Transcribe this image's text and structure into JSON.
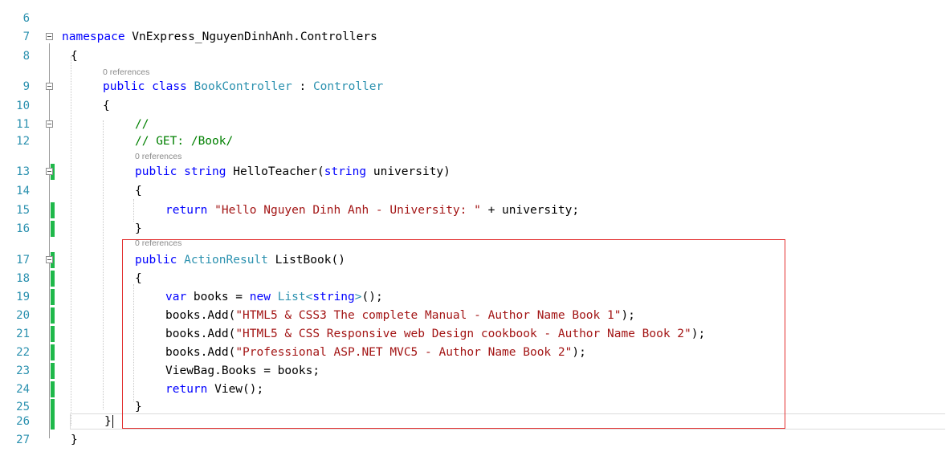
{
  "lines": [
    {
      "num": "6"
    },
    {
      "num": "7",
      "parts": [
        [
          "kw",
          "namespace"
        ],
        [
          "",
          "VnExpress_NguyenDinhAnh.Controllers"
        ]
      ],
      "sep": " "
    },
    {
      "num": "8",
      "text": "{"
    },
    {
      "lens": "0 references"
    },
    {
      "num": "9",
      "text_public": "public",
      "text_class": "class",
      "class_name": "BookController",
      "colon": ":",
      "base": "Controller"
    },
    {
      "num": "10",
      "text": "{"
    },
    {
      "num": "11",
      "comment": "//"
    },
    {
      "num": "12",
      "comment": "// GET: /Book/"
    },
    {
      "lens": "0 references"
    },
    {
      "num": "13"
    },
    {
      "num": "14",
      "text": "{"
    },
    {
      "num": "15"
    },
    {
      "num": "16",
      "text": "}"
    },
    {
      "lens": "0 references"
    },
    {
      "num": "17"
    },
    {
      "num": "18",
      "text": "{"
    },
    {
      "num": "19"
    },
    {
      "num": "20"
    },
    {
      "num": "21"
    },
    {
      "num": "22"
    },
    {
      "num": "23"
    },
    {
      "num": "24"
    },
    {
      "num": "25",
      "text": "}"
    },
    {
      "num": "26",
      "text": "}"
    },
    {
      "num": "27",
      "text": "}"
    }
  ],
  "code": {
    "l6": "6",
    "l7": "7",
    "l8": "8",
    "l9": "9",
    "l10": "10",
    "l11": "11",
    "l12": "12",
    "l13": "13",
    "l14": "14",
    "l15": "15",
    "l16": "16",
    "l17": "17",
    "l18": "18",
    "l19": "19",
    "l20": "20",
    "l21": "21",
    "l22": "22",
    "l23": "23",
    "l24": "24",
    "l25": "25",
    "l26": "26",
    "l27": "27",
    "kw_namespace": "namespace",
    "namespace_name": " VnExpress_NguyenDinhAnh.Controllers",
    "brace_open": "{",
    "brace_close": "}",
    "lens_refs": "0 references",
    "kw_public": "public",
    "kw_class": "class",
    "class_name": "BookController",
    "colon": " : ",
    "base_class": "Controller",
    "comment_1": "//",
    "comment_2": "// GET: /Book/",
    "kw_string": "string",
    "method1_name": " HelloTeacher(",
    "param_name": " university)",
    "kw_return": "return",
    "str_hello": "\"Hello Nguyen Dinh Anh - University: \"",
    "concat_tail": " + university;",
    "type_actionresult": "ActionResult",
    "method2_name": " ListBook()",
    "kw_var": "var",
    "var_books": " books = ",
    "kw_new": "new",
    "type_list": "List",
    "generic_open": "<",
    "generic_close": ">",
    "list_tail": "();",
    "add_call": "books.Add(",
    "str_book1": "\"HTML5 & CSS3 The complete Manual - Author Name Book 1\"",
    "str_book2": "\"HTML5 & CSS Responsive web Design cookbook - Author Name Book 2\"",
    "str_book3": "\"Professional ASP.NET MVC5 - Author Name Book 2\"",
    "call_end": ");",
    "viewbag": "ViewBag.Books = books;",
    "view_call": " View();"
  }
}
